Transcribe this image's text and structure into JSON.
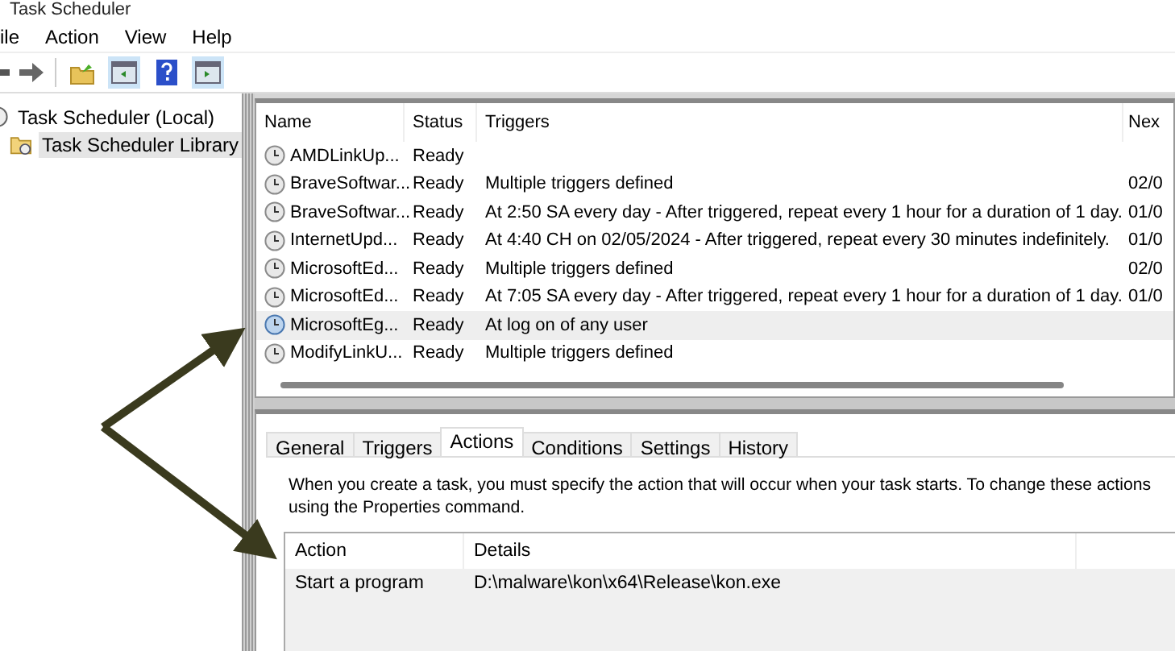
{
  "window": {
    "title": "Task Scheduler"
  },
  "menu": [
    {
      "label": "ile"
    },
    {
      "label": "Action"
    },
    {
      "label": "View"
    },
    {
      "label": "Help"
    }
  ],
  "tree": {
    "items": [
      {
        "label": "Task Scheduler (Local)",
        "selected": false,
        "children": [
          {
            "label": "Task Scheduler Library",
            "selected": true
          }
        ]
      }
    ]
  },
  "task_list": {
    "columns": [
      "Name",
      "Status",
      "Triggers",
      "Nex"
    ],
    "rows": [
      {
        "cells": [
          "AMDLinkUp...",
          "Ready",
          "",
          ""
        ],
        "selected": false
      },
      {
        "cells": [
          "BraveSoftwar...",
          "Ready",
          "Multiple triggers defined",
          "02/0"
        ],
        "selected": false
      },
      {
        "cells": [
          "BraveSoftwar...",
          "Ready",
          "At 2:50 SA every day - After triggered, repeat every 1 hour for a duration of 1 day.",
          "01/0"
        ],
        "selected": false
      },
      {
        "cells": [
          "InternetUpd...",
          "Ready",
          "At 4:40 CH on 02/05/2024 - After triggered, repeat every 30 minutes indefinitely.",
          "01/0"
        ],
        "selected": false
      },
      {
        "cells": [
          "MicrosoftEd...",
          "Ready",
          "Multiple triggers defined",
          "02/0"
        ],
        "selected": false
      },
      {
        "cells": [
          "MicrosoftEd...",
          "Ready",
          "At 7:05 SA every day - After triggered, repeat every 1 hour for a duration of 1 day.",
          "01/0"
        ],
        "selected": false
      },
      {
        "cells": [
          "MicrosoftEg...",
          "Ready",
          "At log on of any user",
          ""
        ],
        "selected": true
      },
      {
        "cells": [
          "ModifyLinkU...",
          "Ready",
          "Multiple triggers defined",
          ""
        ],
        "selected": false
      }
    ]
  },
  "tabs": [
    {
      "label": "General",
      "selected": false
    },
    {
      "label": "Triggers",
      "selected": false
    },
    {
      "label": "Actions",
      "selected": true
    },
    {
      "label": "Conditions",
      "selected": false
    },
    {
      "label": "Settings",
      "selected": false
    },
    {
      "label": "History",
      "selected": false
    }
  ],
  "actions_pane": {
    "description": [
      "When you create a task, you must specify the action that will occur when your task starts.  To change these actions",
      "using the Properties command."
    ],
    "columns": [
      "Action",
      "Details"
    ],
    "rows": [
      {
        "cells": [
          "Start a program",
          "D:\\malware\\kon\\x64\\Release\\kon.exe"
        ]
      }
    ]
  }
}
